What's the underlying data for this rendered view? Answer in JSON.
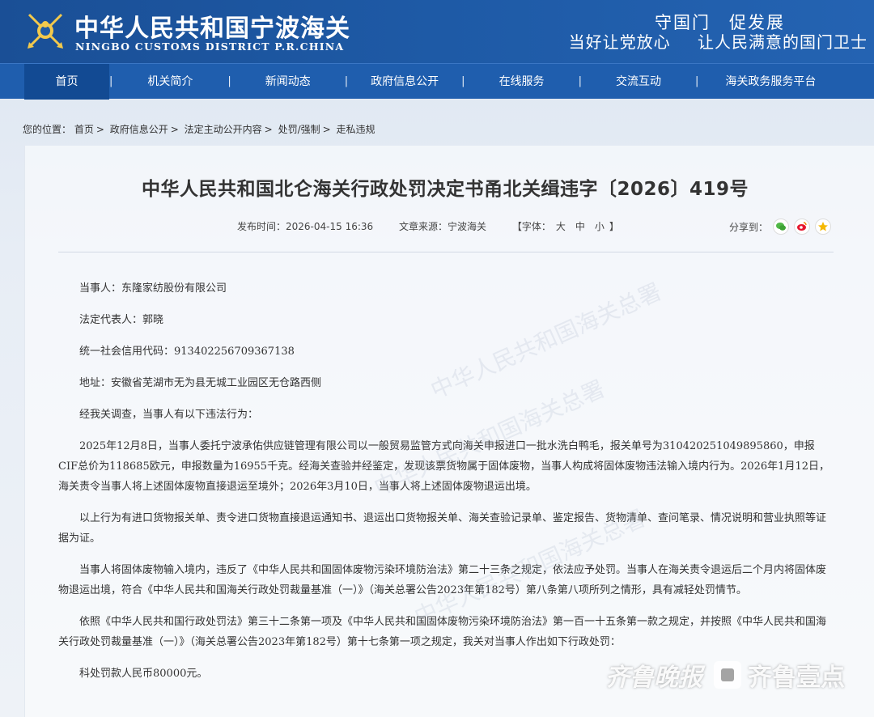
{
  "header": {
    "title_cn": "中华人民共和国宁波海关",
    "title_en": "NINGBO CUSTOMS DISTRICT P.R.CHINA",
    "slogan_top": "守国门　促发展",
    "slogan_left": "当好让党放心",
    "slogan_right": "让人民满意的国门卫士",
    "brand_color": "#1e5aa6"
  },
  "nav": {
    "items": [
      {
        "label": "首页"
      },
      {
        "label": "机关简介"
      },
      {
        "label": "新闻动态"
      },
      {
        "label": "政府信息公开"
      },
      {
        "label": "在线服务"
      },
      {
        "label": "交流互动"
      },
      {
        "label": "海关政务服务平台"
      }
    ],
    "separator": "|"
  },
  "breadcrumb": {
    "prefix": "您的位置：",
    "items": [
      "首页",
      "政府信息公开",
      "法定主动公开内容",
      "处罚/强制",
      "走私违规"
    ],
    "separator": ">"
  },
  "article": {
    "title": "中华人民共和国北仑海关行政处罚决定书甬北关缉违字〔2026〕419号",
    "publish_label": "发布时间：",
    "publish_time": "2026-04-15 16:36",
    "source_label": "文章来源：",
    "source": "宁波海关",
    "font_label": "【字体：",
    "font_large": "大",
    "font_medium": "中",
    "font_small": "小",
    "font_close": "】",
    "share_label": "分享到：",
    "share_icons": [
      "wechat-icon",
      "weibo-icon",
      "qzone-icon"
    ],
    "paragraphs": [
      "当事人：东隆家纺股份有限公司",
      "法定代表人：郭晓",
      "统一社会信用代码：913402256709367138",
      "地址：安徽省芜湖市无为县无城工业园区无仓路西侧",
      "经我关调查，当事人有以下违法行为：",
      "2025年12月8日，当事人委托宁波承佑供应链管理有限公司以一般贸易监管方式向海关申报进口一批水洗白鸭毛，报关单号为310420251049895860，申报CIF总价为118685欧元，申报数量为16955千克。经海关查验并经鉴定，发现该票货物属于固体废物，当事人构成将固体废物违法输入境内行为。2026年1月12日，海关责令当事人将上述固体废物直接退运至境外；2026年3月10日，当事人将上述固体废物退运出境。",
      "以上行为有进口货物报关单、责令进口货物直接退运通知书、退运出口货物报关单、海关查验记录单、鉴定报告、货物清单、查问笔录、情况说明和营业执照等证据为证。",
      "当事人将固体废物输入境内，违反了《中华人民共和国固体废物污染环境防治法》第二十三条之规定，依法应予处罚。当事人在海关责令退运后二个月内将固体废物退运出境，符合《中华人民共和国海关行政处罚裁量基准（一）》（海关总署公告2023年第182号）第八条第八项所列之情形，具有减轻处罚情节。",
      "依照《中华人民共和国行政处罚法》第三十二条第一项及《中华人民共和国固体废物污染环境防治法》第一百一十五条第一款之规定，并按照《中华人民共和国海关行政处罚裁量基准（一）》（海关总署公告2023年第182号）第十七条第一项之规定，我关对当事人作出如下行政处罚：",
      "科处罚款人民币80000元。"
    ]
  },
  "watermark": {
    "text": "中华人民共和国海关总署",
    "brand": "齐鲁晚报",
    "brand2": "齐鲁壹点"
  }
}
